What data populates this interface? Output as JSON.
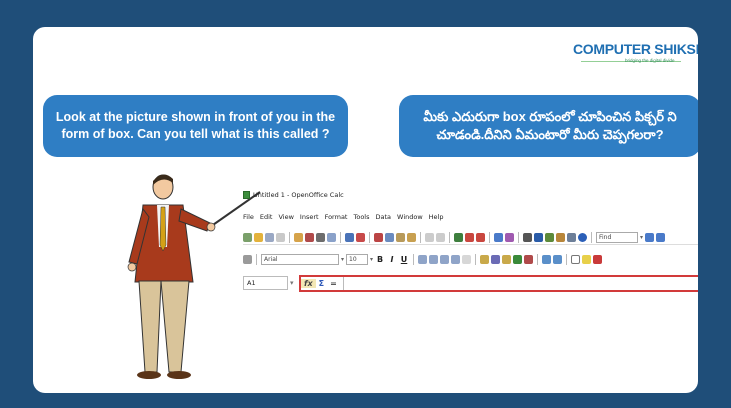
{
  "logo": {
    "name": "COMPUTER SHIKSHA",
    "tagline": "bridging the digital divide"
  },
  "bubbles": {
    "english": "Look at the picture shown in front of you in the form of box. Can you tell what is this called ?",
    "telugu": "మీకు ఎదురుగా box రూపంలో చూపించిన పిక్చర్ ని చూడండి.దీనిని ఏమంటారో మీరు చెప్పగలరా?"
  },
  "app": {
    "title": "Untitled 1 - OpenOffice Calc",
    "menu": [
      "File",
      "Edit",
      "View",
      "Insert",
      "Format",
      "Tools",
      "Data",
      "Window",
      "Help"
    ],
    "find_placeholder": "Find",
    "font_name": "Arial",
    "font_size": "10",
    "format_buttons": [
      "B",
      "I",
      "U"
    ],
    "name_box": "A1",
    "formula_icons": {
      "function_wizard": "fx",
      "sum": "Σ",
      "function": "="
    },
    "formula_value": ""
  },
  "colors": {
    "background": "#1f4e79",
    "bubble": "#2f7ec4",
    "highlight": "#d23a3a"
  }
}
